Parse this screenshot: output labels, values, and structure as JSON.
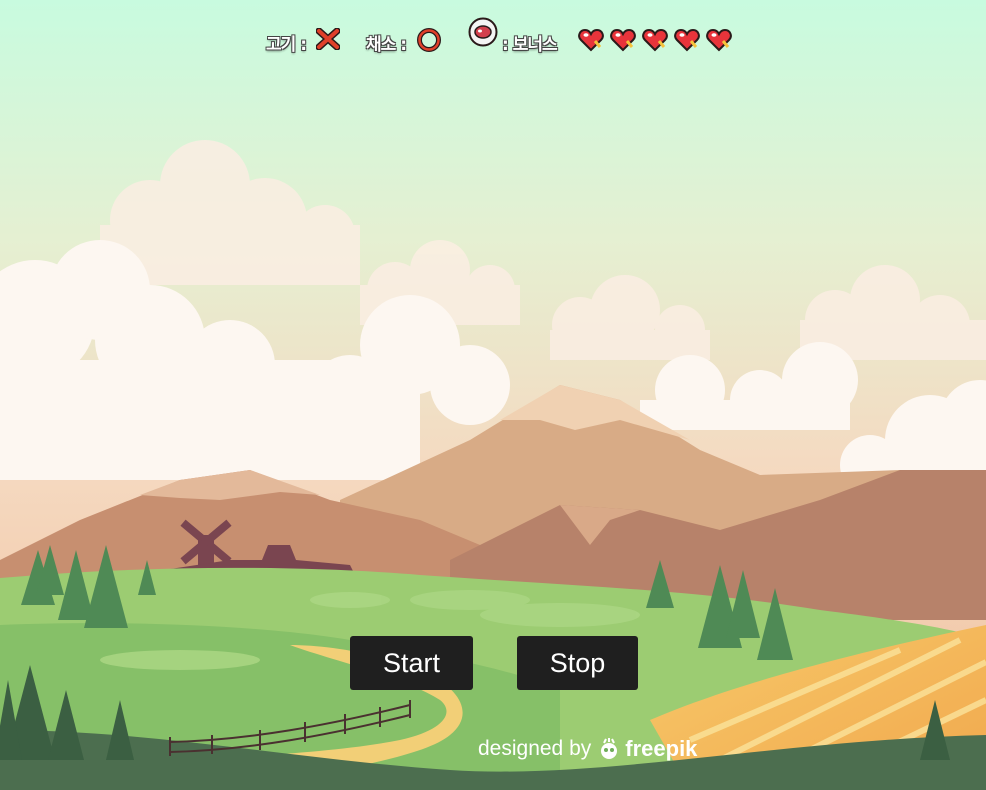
{
  "legend": {
    "meat_label": "고기 :",
    "meat_icon": "x-mark-icon",
    "veggie_label": "채소 :",
    "veggie_icon": "o-ring-icon",
    "bonus_label": ": 보너스",
    "bonus_icon": "meat-bonus-icon"
  },
  "lives": {
    "count": 5,
    "icon": "heart-icon",
    "color": "#e8343b"
  },
  "controls": {
    "start_label": "Start",
    "stop_label": "Stop"
  },
  "credit": {
    "prefix": "designed by",
    "brand": "freepik"
  },
  "colors": {
    "button_bg": "#1f1f1f",
    "sky_top": "#c7fbe0",
    "sky_bottom": "#f3c8a8",
    "grass": "#8dc46a"
  }
}
